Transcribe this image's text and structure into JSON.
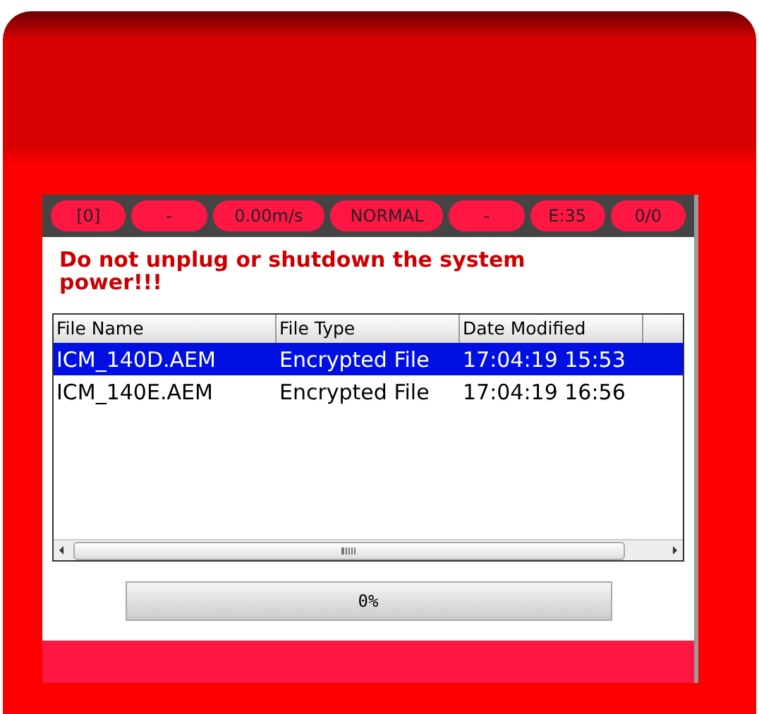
{
  "status_bar": [
    {
      "text": "[0]"
    },
    {
      "text": "-"
    },
    {
      "text": "0.00m/s"
    },
    {
      "text": "NORMAL"
    },
    {
      "text": "-"
    },
    {
      "text": "E:35"
    },
    {
      "text": "0/0"
    }
  ],
  "warning": "Do not unplug or shutdown the system power!!!",
  "table": {
    "columns": [
      "File Name",
      "File Type",
      "Date Modified"
    ],
    "rows": [
      {
        "cells": [
          "ICM_140D.AEM",
          "Encrypted File",
          "17:04:19 15:53"
        ],
        "selected": true
      },
      {
        "cells": [
          "ICM_140E.AEM",
          "Encrypted File",
          "17:04:19 16:56"
        ],
        "selected": false
      }
    ]
  },
  "progress": {
    "level": 0,
    "text": "0%"
  }
}
